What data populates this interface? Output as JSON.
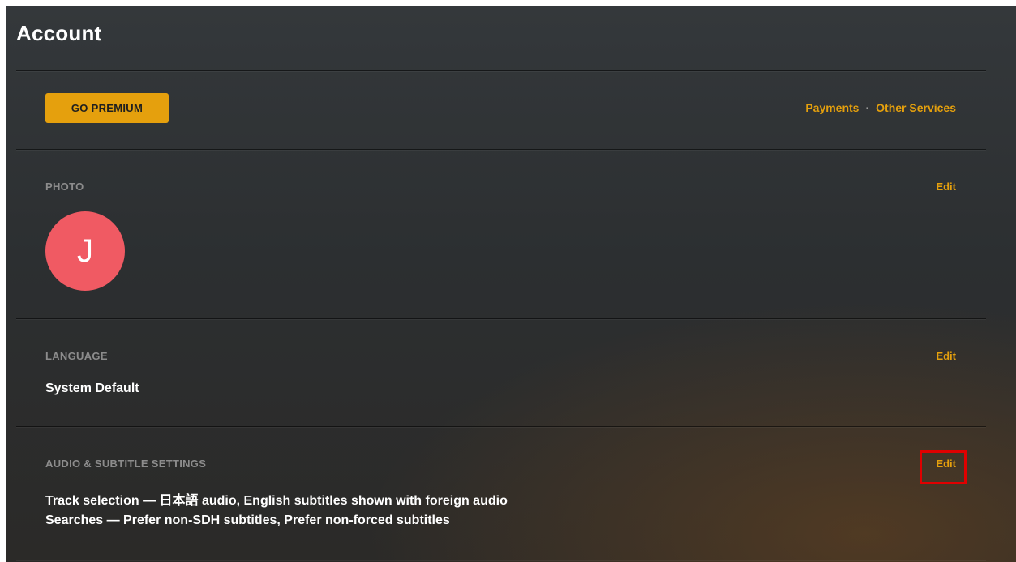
{
  "page": {
    "title": "Account"
  },
  "premium": {
    "button_label": "GO PREMIUM"
  },
  "top_links": {
    "payments": "Payments",
    "separator": "·",
    "other_services": "Other Services"
  },
  "sections": {
    "photo": {
      "label": "PHOTO",
      "edit": "Edit",
      "avatar_letter": "J",
      "avatar_color": "#f05a63"
    },
    "language": {
      "label": "LANGUAGE",
      "edit": "Edit",
      "value": "System Default"
    },
    "audio_subtitle": {
      "label": "AUDIO & SUBTITLE SETTINGS",
      "edit": "Edit",
      "track_selection": "Track selection — 日本語 audio, English subtitles shown with foreign audio",
      "searches": "Searches — Prefer non-SDH subtitles, Prefer non-forced subtitles"
    }
  },
  "colors": {
    "accent": "#e5a00d",
    "highlight": "#e00000"
  }
}
